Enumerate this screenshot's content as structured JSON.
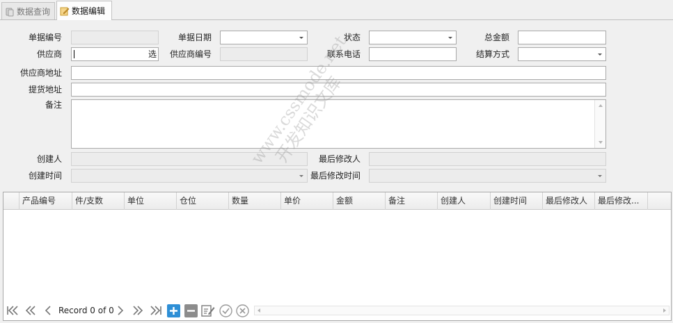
{
  "tabs": [
    {
      "label": "数据查询",
      "icon": "database-icon",
      "active": false
    },
    {
      "label": "数据编辑",
      "icon": "edit-icon",
      "active": true
    }
  ],
  "form": {
    "bill_no": {
      "label": "单据编号",
      "value": ""
    },
    "bill_date": {
      "label": "单据日期",
      "value": ""
    },
    "status": {
      "label": "状态",
      "value": ""
    },
    "total_amount": {
      "label": "总金额",
      "value": ""
    },
    "supplier": {
      "label": "供应商",
      "value": "",
      "button": "选"
    },
    "supplier_code": {
      "label": "供应商编号",
      "value": ""
    },
    "phone": {
      "label": "联系电话",
      "value": ""
    },
    "settlement": {
      "label": "结算方式",
      "value": ""
    },
    "supplier_address": {
      "label": "供应商地址",
      "value": ""
    },
    "pickup_address": {
      "label": "提货地址",
      "value": ""
    },
    "remark": {
      "label": "备注",
      "value": ""
    },
    "creator": {
      "label": "创建人",
      "value": ""
    },
    "modifier": {
      "label": "最后修改人",
      "value": ""
    },
    "create_time": {
      "label": "创建时间",
      "value": ""
    },
    "modify_time": {
      "label": "最后修改时间",
      "value": ""
    }
  },
  "grid": {
    "columns": [
      "产品编号",
      "件/支数",
      "单位",
      "仓位",
      "数量",
      "单价",
      "金额",
      "备注",
      "创建人",
      "创建时间",
      "最后修改人",
      "最后修改..."
    ],
    "rows": []
  },
  "navigator": {
    "record_text": "Record 0 of 0",
    "buttons": [
      "first-icon",
      "prev-page-icon",
      "prev-icon",
      "next-icon",
      "next-page-icon",
      "last-icon",
      "add-icon",
      "remove-icon",
      "edit-icon",
      "confirm-icon",
      "cancel-icon"
    ]
  },
  "watermark": {
    "line1": "www.cssmode.net",
    "line2": "开发知识文库"
  },
  "colors": {
    "accent_blue": "#2e8fd6",
    "remove_gray": "#8c8c8c",
    "icon_gray": "#7a7a7a"
  }
}
